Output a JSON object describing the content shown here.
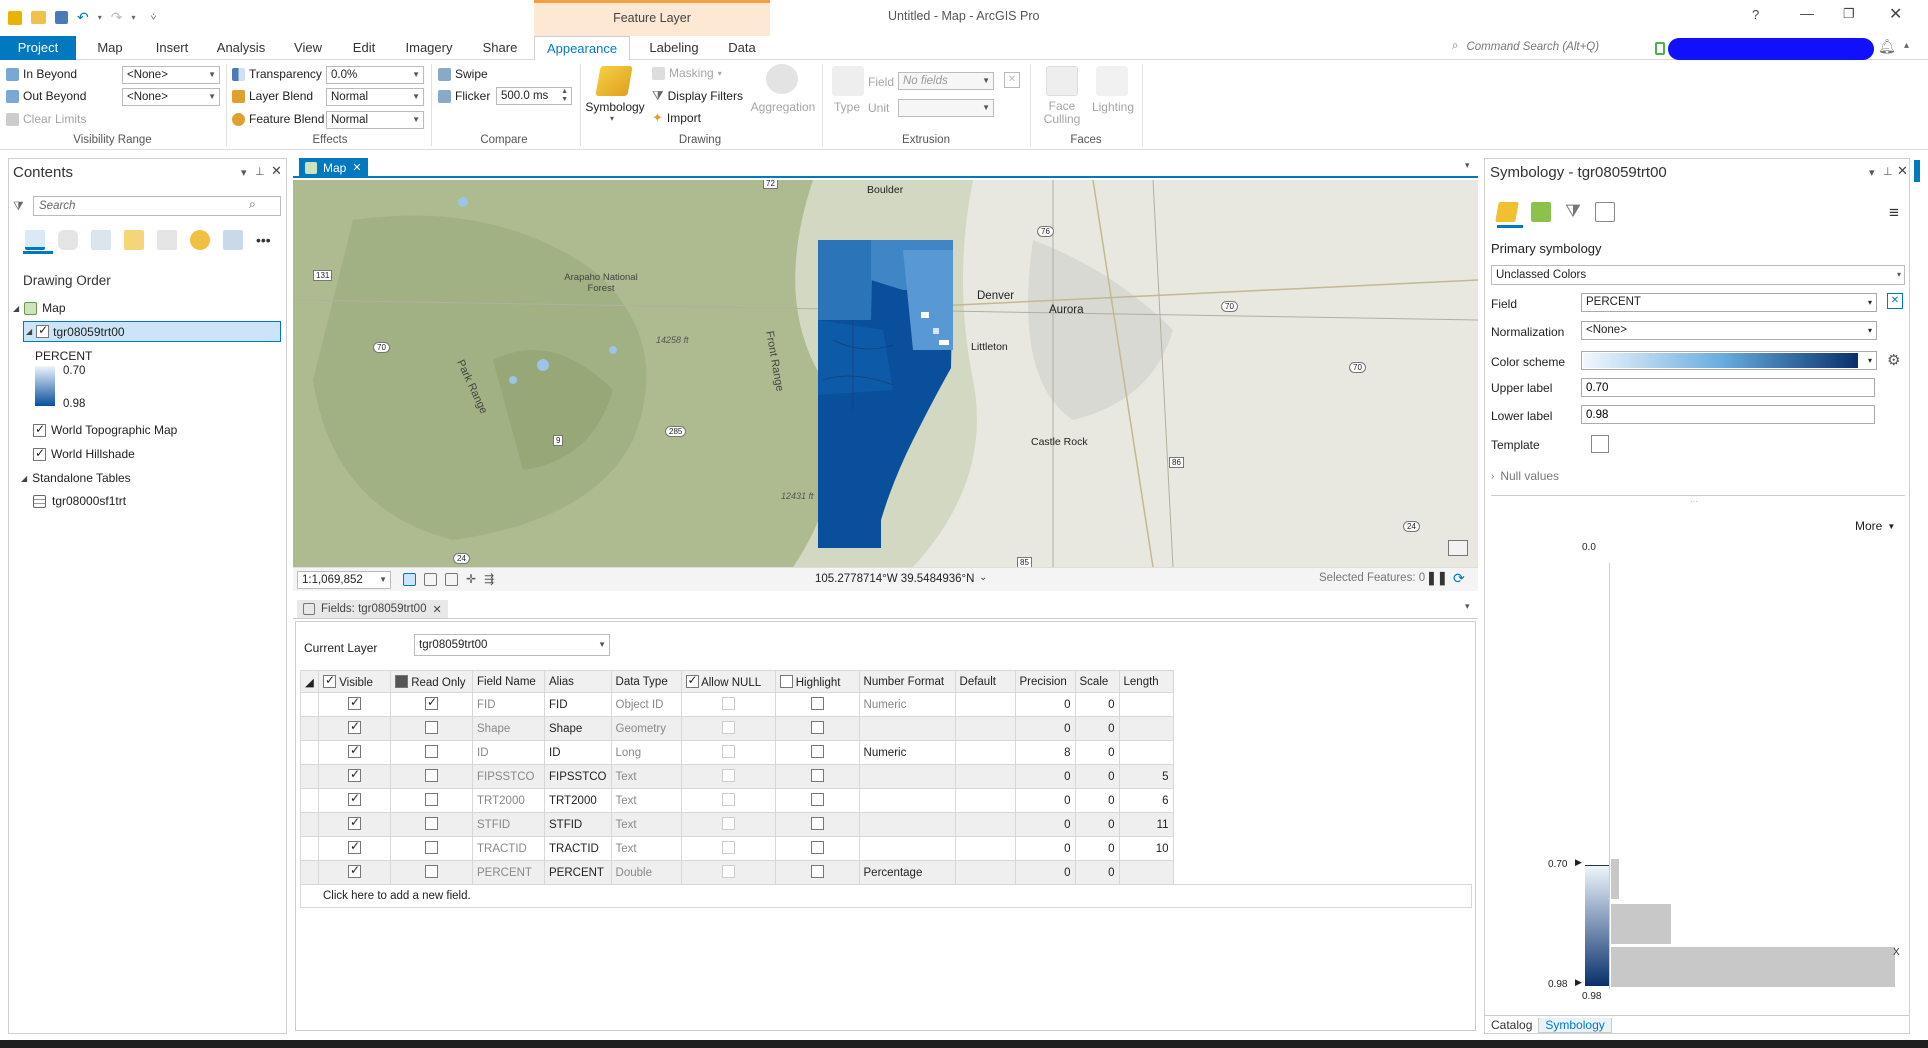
{
  "window": {
    "title": "Untitled - Map - ArcGIS Pro",
    "contextual_tab": "Feature Layer",
    "help": "?",
    "command_search_placeholder": "Command Search (Alt+Q)"
  },
  "ribbon_tabs": [
    "Project",
    "Map",
    "Insert",
    "Analysis",
    "View",
    "Edit",
    "Imagery",
    "Share",
    "Appearance",
    "Labeling",
    "Data"
  ],
  "ribbon": {
    "visibility": {
      "in_beyond": "In Beyond",
      "out_beyond": "Out Beyond",
      "clear_limits": "Clear Limits",
      "in_value": "<None>",
      "out_value": "<None>",
      "label": "Visibility Range"
    },
    "effects": {
      "transparency": "Transparency",
      "transparency_value": "0.0%",
      "layer_blend": "Layer Blend",
      "layer_blend_value": "Normal",
      "feature_blend": "Feature Blend",
      "feature_blend_value": "Normal",
      "label": "Effects"
    },
    "compare": {
      "swipe": "Swipe",
      "flicker": "Flicker",
      "flicker_value": "500.0  ms",
      "label": "Compare"
    },
    "drawing": {
      "symbology": "Symbology",
      "masking": "Masking",
      "display_filters": "Display Filters",
      "import": "Import",
      "aggregation": "Aggregation",
      "label": "Drawing"
    },
    "extrusion": {
      "type": "Type",
      "field": "Field",
      "field_value": "No fields",
      "unit": "Unit",
      "label": "Extrusion"
    },
    "faces": {
      "face_culling": "Face Culling",
      "lighting": "Lighting",
      "label": "Faces"
    }
  },
  "contents": {
    "title": "Contents",
    "search_placeholder": "Search",
    "drawing_order": "Drawing Order",
    "map": "Map",
    "layer": "tgr08059trt00",
    "legend_field": "PERCENT",
    "legend_upper": "0.70",
    "legend_lower": "0.98",
    "basemap1": "World Topographic Map",
    "basemap2": "World Hillshade",
    "standalone": "Standalone Tables",
    "table": "tgr08000sf1trt"
  },
  "map_view": {
    "tab": "Map",
    "places": {
      "boulder": "Boulder",
      "denver": "Denver",
      "aurora": "Aurora",
      "littleton": "Littleton",
      "castle_rock": "Castle Rock",
      "arapaho": "Arapaho National Forest",
      "front_range": "Front Range",
      "park_range": "Park Range",
      "peak1": "14258 ft",
      "peak2": "12431 ft"
    },
    "shields": [
      "72",
      "76",
      "131",
      "70",
      "70",
      "70",
      "285",
      "9",
      "86",
      "24",
      "24",
      "85"
    ],
    "scale": "1:1,069,852",
    "coords": "105.2778714°W 39.5484936°N",
    "selected": "Selected Features: 0"
  },
  "fields_view": {
    "tab": "Fields:  tgr08059trt00",
    "current_layer_label": "Current Layer",
    "current_layer": "tgr08059trt00",
    "columns": [
      "Visible",
      "Read Only",
      "Field Name",
      "Alias",
      "Data Type",
      "Allow NULL",
      "Highlight",
      "Number Format",
      "Default",
      "Precision",
      "Scale",
      "Length"
    ],
    "rows": [
      {
        "name": "FID",
        "alias": "FID",
        "type": "Object ID",
        "format": "Numeric",
        "precision": "0",
        "scale": "0",
        "length": "",
        "ro": true
      },
      {
        "name": "Shape",
        "alias": "Shape",
        "type": "Geometry",
        "format": "",
        "precision": "0",
        "scale": "0",
        "length": "",
        "ro": false
      },
      {
        "name": "ID",
        "alias": "ID",
        "type": "Long",
        "format": "Numeric",
        "precision": "8",
        "scale": "0",
        "length": "",
        "ro": false
      },
      {
        "name": "FIPSSTCO",
        "alias": "FIPSSTCO",
        "type": "Text",
        "format": "",
        "precision": "0",
        "scale": "0",
        "length": "5",
        "ro": false
      },
      {
        "name": "TRT2000",
        "alias": "TRT2000",
        "type": "Text",
        "format": "",
        "precision": "0",
        "scale": "0",
        "length": "6",
        "ro": false
      },
      {
        "name": "STFID",
        "alias": "STFID",
        "type": "Text",
        "format": "",
        "precision": "0",
        "scale": "0",
        "length": "11",
        "ro": false
      },
      {
        "name": "TRACTID",
        "alias": "TRACTID",
        "type": "Text",
        "format": "",
        "precision": "0",
        "scale": "0",
        "length": "10",
        "ro": false
      },
      {
        "name": "PERCENT",
        "alias": "PERCENT",
        "type": "Double",
        "format": "Percentage",
        "precision": "0",
        "scale": "0",
        "length": "",
        "ro": false
      }
    ],
    "add_field": "Click here to add a new field."
  },
  "symbology": {
    "title": "Symbology - tgr08059trt00",
    "primary": "Primary symbology",
    "method": "Unclassed Colors",
    "field_label": "Field",
    "field": "PERCENT",
    "normalization_label": "Normalization",
    "normalization": "<None>",
    "color_scheme_label": "Color scheme",
    "upper_label_label": "Upper label",
    "upper_label": "0.70",
    "lower_label_label": "Lower label",
    "lower_label": "0.98",
    "template_label": "Template",
    "null_values": "Null values",
    "more": "More",
    "hist_top": "0.0",
    "hist_upper": "0.70",
    "hist_lower": "0.98",
    "hist_bottom": "0.98",
    "x_mark": "X"
  },
  "bottom_tabs": {
    "catalog": "Catalog",
    "symbology": "Symbology"
  },
  "colors": {
    "accent": "#0079c1",
    "ramp_light": "#e8f1fa",
    "ramp_dark": "#08306b"
  }
}
